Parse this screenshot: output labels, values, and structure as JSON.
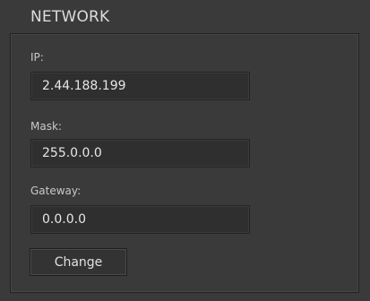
{
  "panel": {
    "title": "NETWORK"
  },
  "fields": {
    "ip": {
      "label": "IP:",
      "value": "2.44.188.199"
    },
    "mask": {
      "label": "Mask:",
      "value": "255.0.0.0"
    },
    "gateway": {
      "label": "Gateway:",
      "value": "0.0.0.0"
    }
  },
  "actions": {
    "change_label": "Change"
  },
  "colors": {
    "background": "#3a3a3a",
    "input_background": "#2f2f2f",
    "text": "#d8d8d8"
  }
}
